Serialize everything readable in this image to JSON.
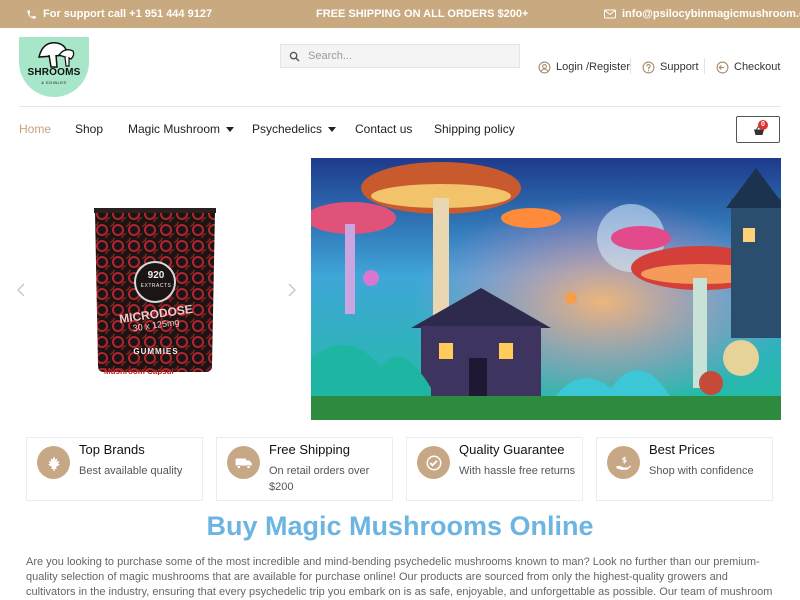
{
  "topbar": {
    "support": "For support call +1 951 444 9127",
    "shipping": "FREE SHIPPING ON ALL ORDERS $200+",
    "email": "info@psilocybinmagicmushroom.org"
  },
  "logo": {
    "text": "SHROOMS",
    "sub": "& EDIBLES"
  },
  "search": {
    "placeholder": "Search..."
  },
  "header_links": {
    "login": "Login /Register",
    "support": "Support",
    "checkout": "Checkout"
  },
  "nav": {
    "items": [
      {
        "label": "Home",
        "active": true
      },
      {
        "label": "Shop"
      },
      {
        "label": "Magic Mushroom",
        "dropdown": true
      },
      {
        "label": "Psychedelics",
        "dropdown": true
      },
      {
        "label": "Contact us"
      },
      {
        "label": "Shipping policy"
      }
    ]
  },
  "cart": {
    "count": "0"
  },
  "slider": {
    "brand_line1": "920",
    "brand_line2": "EXTRACTS",
    "product_line1": "MICRODOSE",
    "product_line2": "30 x 125mg",
    "product_line3": "GUMMIES",
    "caption": "Mushroom Capsul"
  },
  "features": [
    {
      "icon": "maple-leaf-icon",
      "title": "Top Brands",
      "subtitle": "Best available quality"
    },
    {
      "icon": "truck-icon",
      "title": "Free Shipping",
      "subtitle": "On retail orders over $200"
    },
    {
      "icon": "check-icon",
      "title": "Quality Guarantee",
      "subtitle": "With hassle free returns"
    },
    {
      "icon": "price-hand-icon",
      "title": "Best Prices",
      "subtitle": "Shop with confidence"
    }
  ],
  "main": {
    "title": "Buy Magic Mushrooms Online",
    "intro": "Are you looking to purchase some of the most incredible and mind-bending psychedelic mushrooms known to man? Look no further than our premium-quality selection of magic mushrooms that are available for purchase online! Our products are sourced from only the highest-quality growers and cultivators in the industry, ensuring that every psychedelic trip you embark on is as safe, enjoyable, and unforgettable as possible. Our team of mushroom experts goes to great"
  },
  "colors": {
    "topbar": "#c9a97f",
    "accent": "#c9a07a",
    "title_blue": "#6cb4e2",
    "logo_green": "#a8e6c9"
  }
}
